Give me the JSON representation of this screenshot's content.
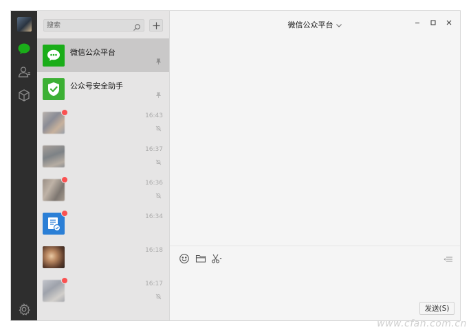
{
  "search": {
    "placeholder": "搜索"
  },
  "navbar": {
    "items": [
      {
        "icon": "chat-icon",
        "active": true
      },
      {
        "icon": "contacts-icon",
        "active": false
      },
      {
        "icon": "favorites-cube-icon",
        "active": false
      }
    ],
    "settings_icon": "gear-icon"
  },
  "sessions": [
    {
      "name": "微信公众平台",
      "time": "",
      "mark": "pin-icon",
      "avatar": "wechat-chat-logo",
      "badge": false,
      "active": true
    },
    {
      "name": "公众号安全助手",
      "time": "",
      "mark": "pin-icon",
      "avatar": "green-shield-logo",
      "badge": false,
      "active": false
    },
    {
      "name": "",
      "time": "16:43",
      "mark": "mute-icon",
      "avatar": "blurred-photo",
      "badge": true,
      "active": false
    },
    {
      "name": "",
      "time": "16:37",
      "mark": "mute-icon",
      "avatar": "blurred-photo",
      "badge": false,
      "active": false
    },
    {
      "name": "",
      "time": "16:36",
      "mark": "mute-icon",
      "avatar": "blurred-photo",
      "badge": true,
      "active": false
    },
    {
      "name": "",
      "time": "16:34",
      "mark": "",
      "avatar": "blue-document-logo",
      "badge": true,
      "active": false
    },
    {
      "name": "",
      "time": "16:18",
      "mark": "",
      "avatar": "blurred-photo",
      "badge": false,
      "active": false
    },
    {
      "name": "",
      "time": "16:17",
      "mark": "mute-icon",
      "avatar": "blurred-photo",
      "badge": true,
      "active": false
    }
  ],
  "chat": {
    "title": "微信公众平台",
    "send_label": "发送(S)"
  },
  "colors": {
    "nav_bg": "#2e2e2e",
    "accent_green": "#07c160",
    "badge_red": "#fa5151",
    "session_bg": "#e6e5e5",
    "active_session_bg": "#c9c8c8",
    "chat_bg": "#f5f5f5"
  },
  "watermark": "www.cfan.com.cn"
}
